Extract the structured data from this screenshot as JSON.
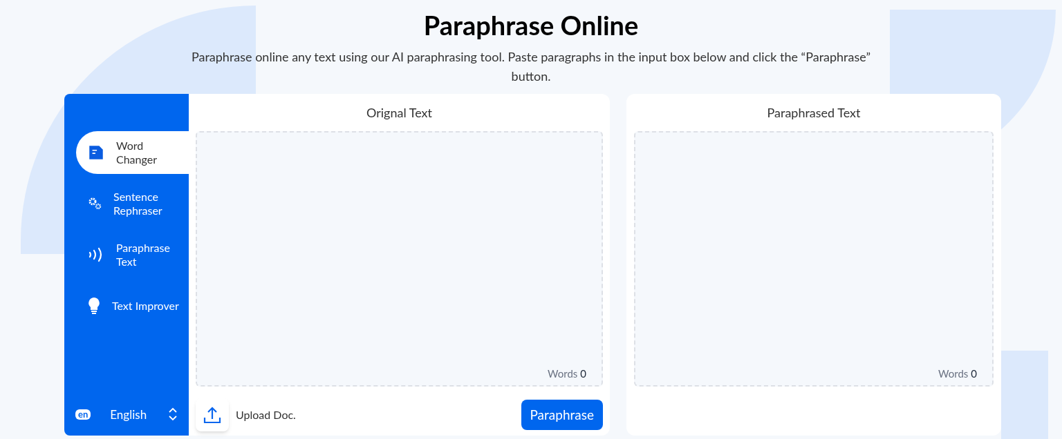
{
  "title": "Paraphrase Online",
  "subtitle": "Paraphrase online any text using our AI paraphrasing tool. Paste paragraphs in the input box below and click the “Paraphrase” button.",
  "tools": [
    {
      "label": "Word Changer",
      "selected": true
    },
    {
      "label": "Sentence Rephraser",
      "selected": false
    },
    {
      "label": "Paraphrase Text",
      "selected": false
    },
    {
      "label": "Text Improver",
      "selected": false
    }
  ],
  "language": {
    "code": "en",
    "name": "English"
  },
  "input_panel": {
    "heading": "Orignal Text",
    "word_label": "Words",
    "word_count": "0",
    "upload_label": "Upload Doc.",
    "button": "Paraphrase"
  },
  "output_panel": {
    "heading": "Paraphrased Text",
    "word_label": "Words",
    "word_count": "0"
  }
}
